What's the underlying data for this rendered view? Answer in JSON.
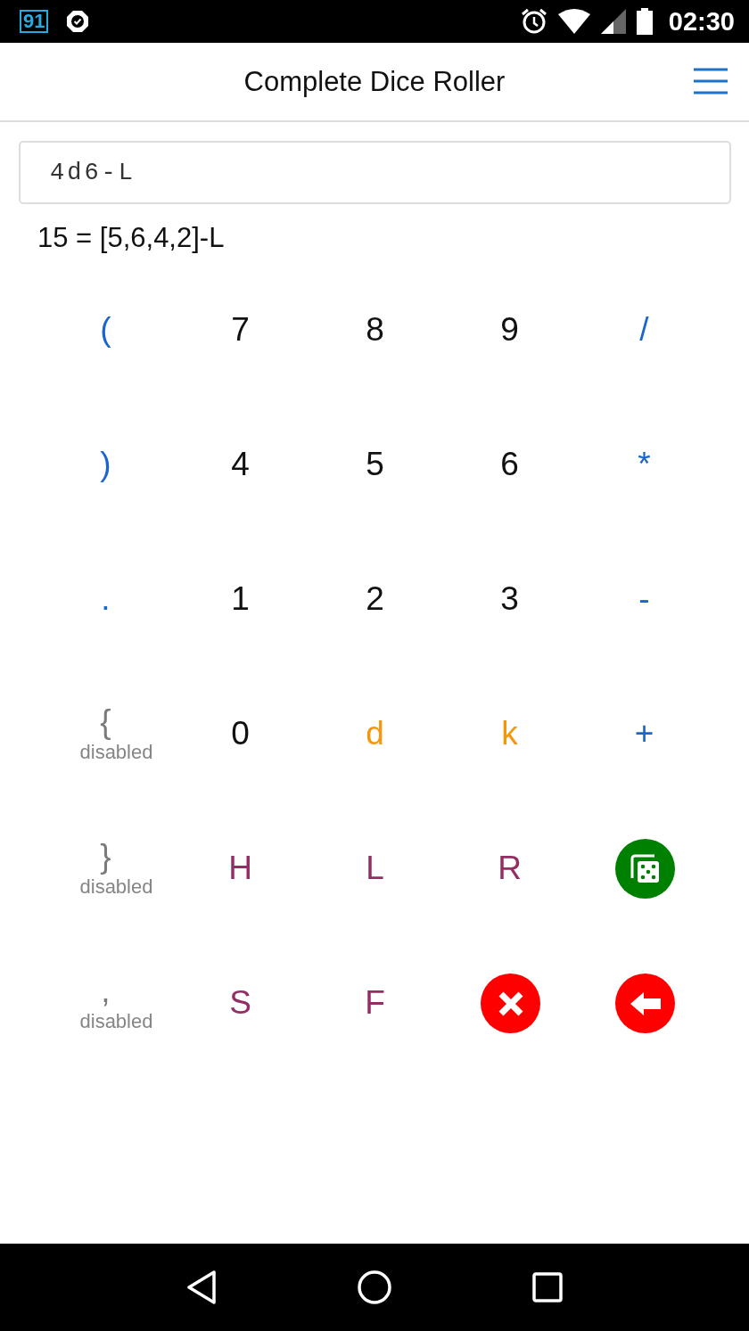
{
  "status_bar": {
    "notification": "91",
    "time": "02:30"
  },
  "app_bar": {
    "title": "Complete Dice Roller"
  },
  "expression_field": {
    "value": "4d6-L"
  },
  "result": "15 = [5,6,4,2]-L",
  "keypad": [
    {
      "kind": "symbol",
      "label": "(",
      "disabled": false
    },
    {
      "kind": "digit",
      "label": "7",
      "disabled": false
    },
    {
      "kind": "digit",
      "label": "8",
      "disabled": false
    },
    {
      "kind": "digit",
      "label": "9",
      "disabled": false
    },
    {
      "kind": "symbol",
      "label": "/",
      "disabled": false
    },
    {
      "kind": "symbol",
      "label": ")",
      "disabled": false
    },
    {
      "kind": "digit",
      "label": "4",
      "disabled": false
    },
    {
      "kind": "digit",
      "label": "5",
      "disabled": false
    },
    {
      "kind": "digit",
      "label": "6",
      "disabled": false
    },
    {
      "kind": "symbol",
      "label": "*",
      "disabled": false
    },
    {
      "kind": "symbol",
      "label": ".",
      "disabled": false
    },
    {
      "kind": "digit",
      "label": "1",
      "disabled": false
    },
    {
      "kind": "digit",
      "label": "2",
      "disabled": false
    },
    {
      "kind": "digit",
      "label": "3",
      "disabled": false
    },
    {
      "kind": "symbol",
      "label": "-",
      "disabled": false
    },
    {
      "kind": "symbol",
      "label": "{",
      "disabled": true,
      "note": "disabled"
    },
    {
      "kind": "digit",
      "label": "0",
      "disabled": false
    },
    {
      "kind": "dice",
      "label": "d",
      "disabled": false
    },
    {
      "kind": "dice",
      "label": "k",
      "disabled": false
    },
    {
      "kind": "symbol",
      "label": "+",
      "disabled": false
    },
    {
      "kind": "symbol",
      "label": "}",
      "disabled": true,
      "note": "disabled"
    },
    {
      "kind": "modifier",
      "label": "H",
      "disabled": false
    },
    {
      "kind": "modifier",
      "label": "L",
      "disabled": false
    },
    {
      "kind": "modifier",
      "label": "R",
      "disabled": false
    },
    {
      "kind": "roll",
      "color": "#008000"
    },
    {
      "kind": "symbol",
      "label": ",",
      "disabled": true,
      "note": "disabled"
    },
    {
      "kind": "modifier",
      "label": "S",
      "disabled": false
    },
    {
      "kind": "modifier",
      "label": "F",
      "disabled": false
    },
    {
      "kind": "clear",
      "color": "#ff0000"
    },
    {
      "kind": "backspace",
      "color": "#ff0000"
    }
  ]
}
